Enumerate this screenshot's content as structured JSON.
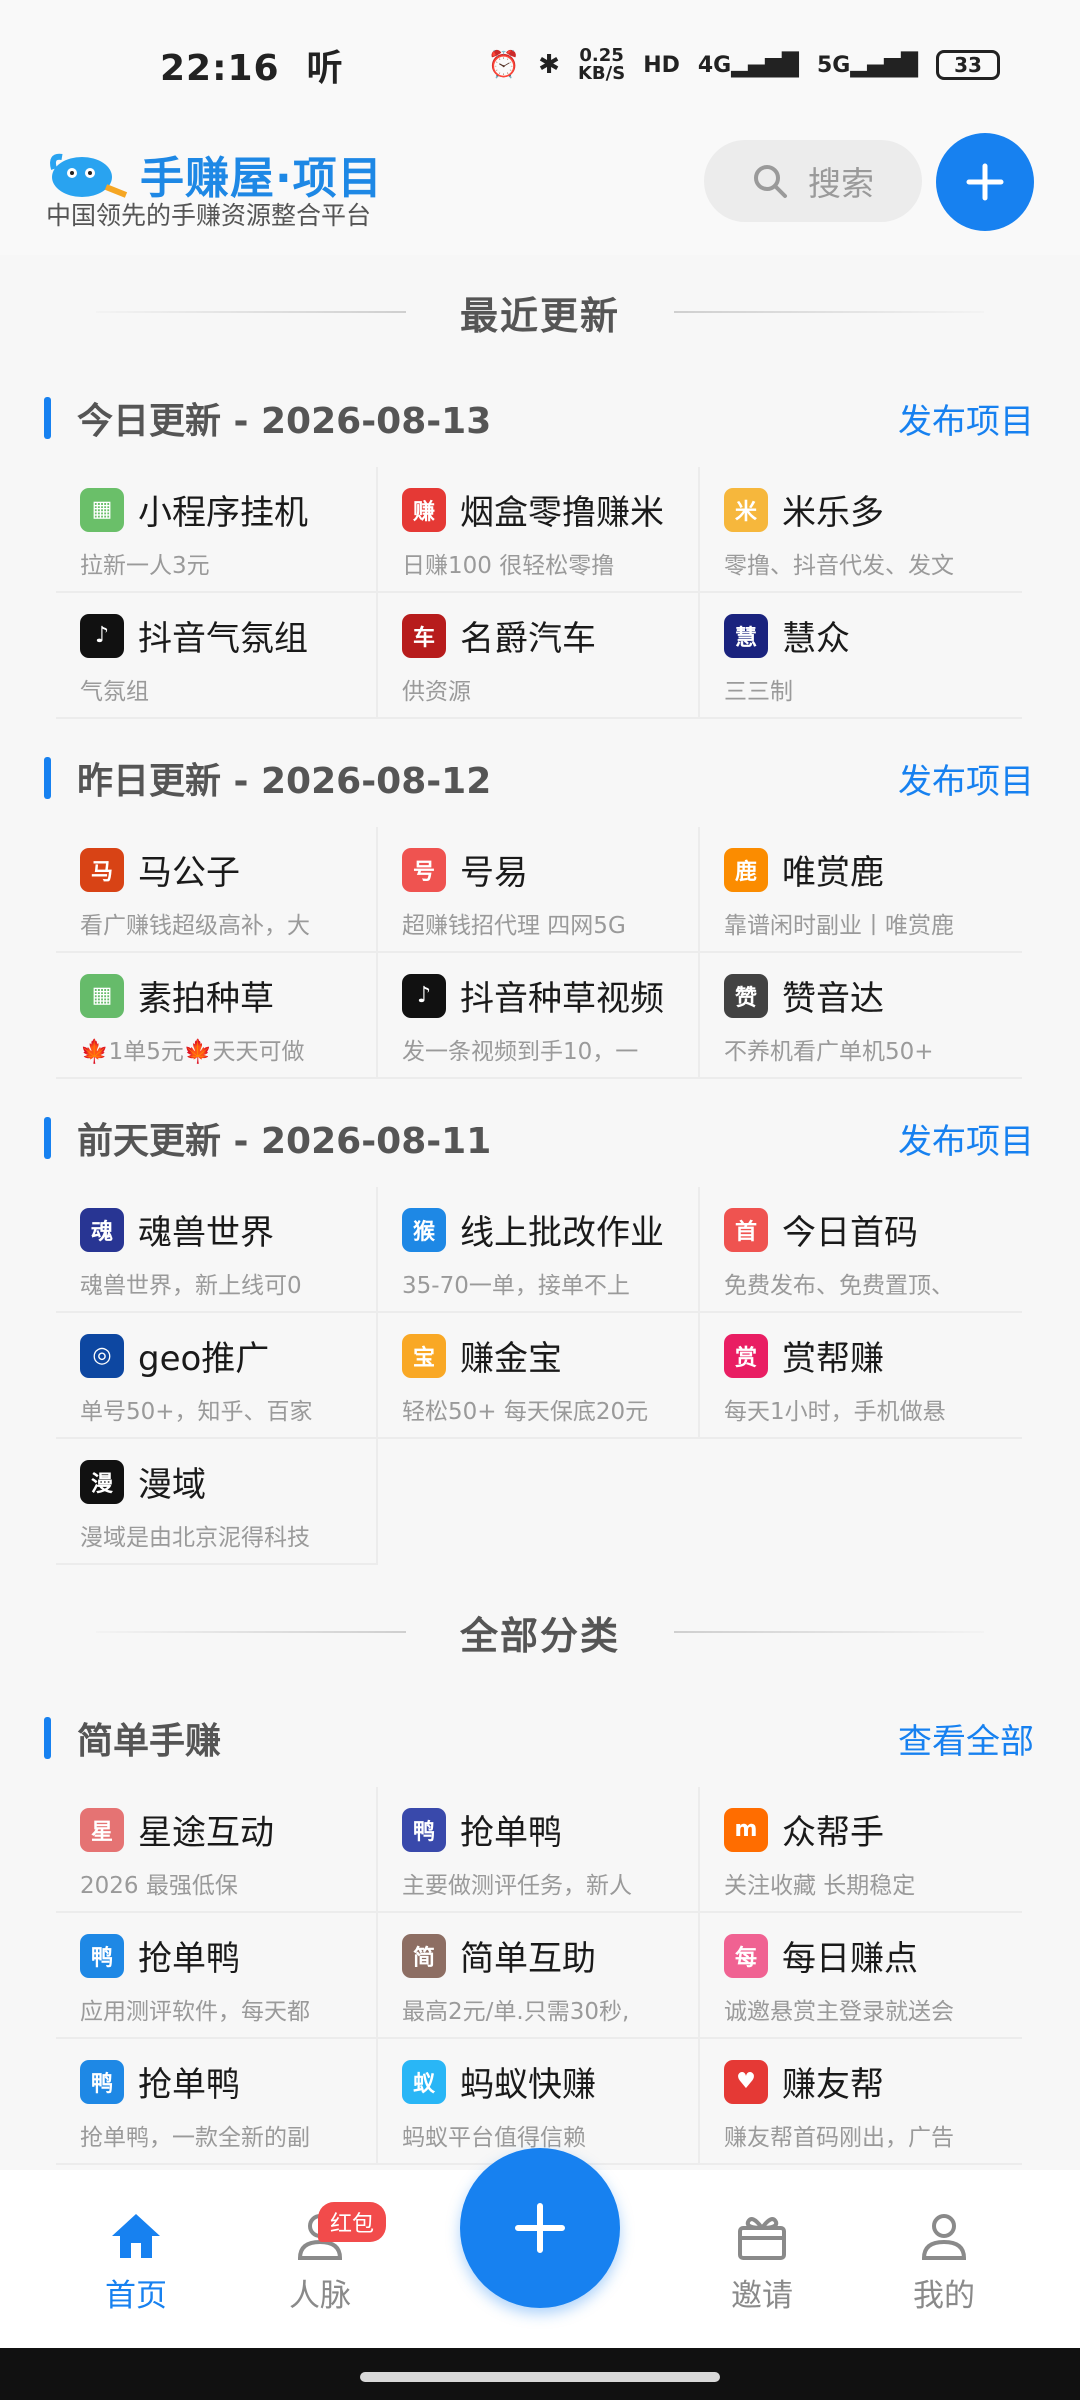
{
  "status": {
    "time": "22:16",
    "time_suffix": "听",
    "speed_top": "0.25",
    "speed_bottom": "KB/S",
    "hd": "HD",
    "net1": "4G",
    "net2": "5G",
    "battery": "33"
  },
  "header": {
    "logo_text": "手赚屋·项目",
    "slogan": "中国领先的手赚资源整合平台",
    "search_placeholder": "搜索"
  },
  "recent_title": "最近更新",
  "sections": [
    {
      "title": "今日更新 - 2026-08-13",
      "action": "发布项目",
      "items": [
        {
          "name": "小程序挂机",
          "desc": "拉新一人3元",
          "icon_color": "#6abf69",
          "icon_glyph": "▦"
        },
        {
          "name": "烟盒零撸赚米",
          "desc": "日赚100 很轻松零撸",
          "icon_color": "#e53935",
          "icon_glyph": "赚"
        },
        {
          "name": "米乐多",
          "desc": "零撸、抖音代发、发文",
          "icon_color": "#f6b73c",
          "icon_glyph": "米"
        },
        {
          "name": "抖音气氛组",
          "desc": "气氛组",
          "icon_color": "#111111",
          "icon_glyph": "♪"
        },
        {
          "name": "名爵汽车",
          "desc": "供资源",
          "icon_color": "#b71c1c",
          "icon_glyph": "车"
        },
        {
          "name": "慧众",
          "desc": "三三制",
          "icon_color": "#1a237e",
          "icon_glyph": "慧"
        }
      ]
    },
    {
      "title": "昨日更新 - 2026-08-12",
      "action": "发布项目",
      "items": [
        {
          "name": "马公子",
          "desc": "看广赚钱超级高补，大",
          "icon_color": "#d84315",
          "icon_glyph": "马"
        },
        {
          "name": "号易",
          "desc": "超赚钱招代理 四网5G",
          "icon_color": "#ef5350",
          "icon_glyph": "号"
        },
        {
          "name": "唯赏鹿",
          "desc": "靠谱闲时副业丨唯赏鹿",
          "icon_color": "#fb8c00",
          "icon_glyph": "鹿"
        },
        {
          "name": "素拍种草",
          "desc": "🍁1单5元🍁天天可做",
          "icon_color": "#66bb6a",
          "icon_glyph": "▦"
        },
        {
          "name": "抖音种草视频",
          "desc": "发一条视频到手10，一",
          "icon_color": "#111111",
          "icon_glyph": "♪"
        },
        {
          "name": "赞音达",
          "desc": "不养机看广单机50+",
          "icon_color": "#424242",
          "icon_glyph": "赞"
        }
      ]
    },
    {
      "title": "前天更新 - 2026-08-11",
      "action": "发布项目",
      "items": [
        {
          "name": "魂兽世界",
          "desc": "魂兽世界，新上线可0",
          "icon_color": "#283593",
          "icon_glyph": "魂"
        },
        {
          "name": "线上批改作业",
          "desc": "35-70一单，接单不上",
          "icon_color": "#1e88e5",
          "icon_glyph": "猴"
        },
        {
          "name": "今日首码",
          "desc": "免费发布、免费置顶、",
          "icon_color": "#ef5350",
          "icon_glyph": "首"
        },
        {
          "name": "geo推广",
          "desc": "单号50+，知乎、百家",
          "icon_color": "#0d47a1",
          "icon_glyph": "◎"
        },
        {
          "name": "赚金宝",
          "desc": "轻松50+ 每天保底20元",
          "icon_color": "#f9a825",
          "icon_glyph": "宝"
        },
        {
          "name": "赏帮赚",
          "desc": "每天1小时，手机做悬",
          "icon_color": "#e91e63",
          "icon_glyph": "赏"
        },
        {
          "name": "漫域",
          "desc": "漫域是由北京泥得科技",
          "icon_color": "#111111",
          "icon_glyph": "漫"
        }
      ]
    }
  ],
  "all_title": "全部分类",
  "category": {
    "title": "简单手赚",
    "action": "查看全部",
    "items": [
      {
        "name": "星途互动",
        "desc": "2026    最强低保",
        "icon_color": "#e57373",
        "icon_glyph": "星"
      },
      {
        "name": "抢单鸭",
        "desc": "主要做测评任务，新人",
        "icon_color": "#3949ab",
        "icon_glyph": "鸭"
      },
      {
        "name": "众帮手",
        "desc": "关注收藏 长期稳定",
        "icon_color": "#ff6d00",
        "icon_glyph": "m"
      },
      {
        "name": "抢单鸭",
        "desc": "应用测评软件，每天都",
        "icon_color": "#1e88e5",
        "icon_glyph": "鸭"
      },
      {
        "name": "简单互助",
        "desc": "最高2元/单.只需30秒,",
        "icon_color": "#8d6e63",
        "icon_glyph": "简"
      },
      {
        "name": "每日赚点",
        "desc": "诚邀悬赏主登录就送会",
        "icon_color": "#f06292",
        "icon_glyph": "每"
      },
      {
        "name": "抢单鸭",
        "desc": "抢单鸭，一款全新的副",
        "icon_color": "#1e88e5",
        "icon_glyph": "鸭"
      },
      {
        "name": "蚂蚁快赚",
        "desc": "蚂蚁平台值得信赖",
        "icon_color": "#29b6f6",
        "icon_glyph": "蚁"
      },
      {
        "name": "赚友帮",
        "desc": "赚友帮首码刚出，广告",
        "icon_color": "#e53935",
        "icon_glyph": "♥"
      }
    ]
  },
  "nav": {
    "home": "首页",
    "network": "人脉",
    "network_badge": "红包",
    "invite": "邀请",
    "mine": "我的"
  },
  "colors": {
    "accent": "#1781f0",
    "badge": "#f24b4b"
  }
}
